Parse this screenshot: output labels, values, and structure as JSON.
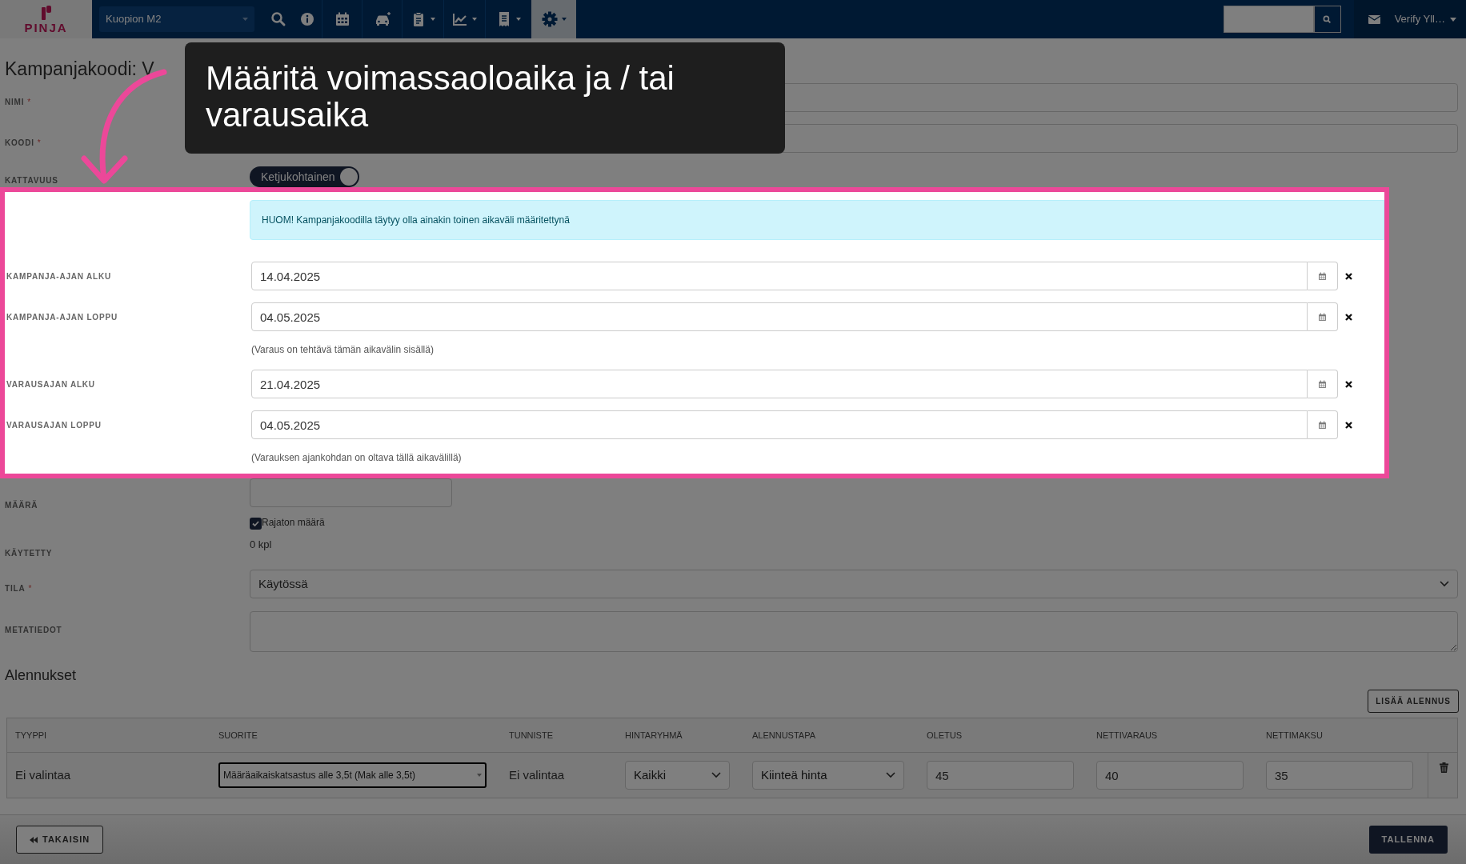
{
  "header": {
    "logo": "PINJA",
    "location": "Kuopion M2",
    "user": "Verify Yll…",
    "nav": [
      {
        "selected": false,
        "dropdown": false
      },
      {
        "selected": false,
        "dropdown": false
      },
      {
        "selected": false,
        "dropdown": false
      },
      {
        "selected": false,
        "dropdown": false
      },
      {
        "selected": false,
        "dropdown": true
      },
      {
        "selected": false,
        "dropdown": true
      },
      {
        "selected": false,
        "dropdown": true
      },
      {
        "selected": true,
        "dropdown": true
      }
    ]
  },
  "title": "Kampanjakoodi: V",
  "form_top": [
    {
      "kind": "text",
      "label": "NIMI",
      "required_mark": "*"
    },
    {
      "kind": "text",
      "label": "KOODI",
      "required_mark": "*"
    },
    {
      "kind": "toggle",
      "label": "KATTAVUUS",
      "value": "Ketjukohtainen",
      "on": true
    }
  ],
  "highlight": {
    "alert": "HUOM! Kampanjakoodilla täytyy olla ainakin toinen aikaväli määritettynä",
    "items": [
      {
        "kind": "date",
        "label": "KAMPANJA-AJAN ALKU",
        "value": "14.04.2025"
      },
      {
        "kind": "date",
        "label": "KAMPANJA-AJAN LOPPU",
        "value": "04.05.2025"
      },
      {
        "kind": "note",
        "text": "(Varaus on tehtävä tämän aikavälin sisällä)"
      },
      {
        "kind": "date",
        "label": "VARAUSAJAN ALKU",
        "value": "21.04.2025"
      },
      {
        "kind": "date",
        "label": "VARAUSAJAN LOPPU",
        "value": "04.05.2025"
      },
      {
        "kind": "note",
        "text": "(Varauksen ajankohdan on oltava tällä aikavälillä)"
      }
    ]
  },
  "form_bottom": [
    {
      "kind": "number",
      "label": "MÄÄRÄ",
      "disabled": true,
      "checkbox": {
        "label": "Rajaton määrä",
        "checked": true
      }
    },
    {
      "kind": "info",
      "label": "KÄYTETTY",
      "value": "0 kpl"
    },
    {
      "kind": "select",
      "label": "TILA",
      "required_mark": "*",
      "value": "Käytössä"
    },
    {
      "kind": "textarea",
      "label": "METATIEDOT"
    }
  ],
  "discounts": {
    "title": "Alennukset",
    "add_button": "LISÄÄ ALENNUS",
    "columns": [
      "TYYPPI",
      "SUORITE",
      "TUNNISTE",
      "HINTARYHMÄ",
      "ALENNUSTAPA",
      "OLETUS",
      "NETTIVARAUS",
      "NETTIMAKSU"
    ],
    "rows": [
      {
        "cells": [
          {
            "kind": "text",
            "value": "Ei valintaa"
          },
          {
            "kind": "combo",
            "value": "Määräaikaiskatsastus alle 3,5t (Mak alle 3,5t)"
          },
          {
            "kind": "text",
            "value": "Ei valintaa"
          },
          {
            "kind": "select",
            "value": "Kaikki"
          },
          {
            "kind": "select",
            "value": "Kiinteä hinta"
          },
          {
            "kind": "input",
            "value": "45"
          },
          {
            "kind": "input",
            "value": "40"
          },
          {
            "kind": "input",
            "value": "35"
          }
        ]
      }
    ]
  },
  "footer": {
    "back": "TAKAISIN",
    "save": "TALLENNA"
  },
  "tip": {
    "text": "Määritä voimassaoloaika ja / tai varausaika"
  }
}
